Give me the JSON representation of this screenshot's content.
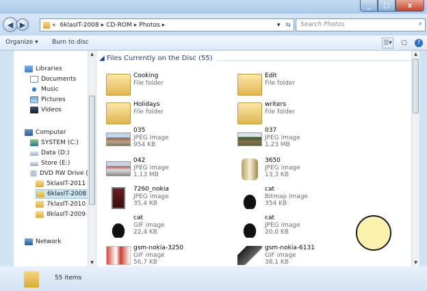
{
  "titlebar": {
    "minimize": "_",
    "maximize": "□",
    "close": "x"
  },
  "nav": {
    "back": "◀",
    "forward": "▶",
    "chevron": "«",
    "crumbs": [
      "6klasIT-2008",
      "CD-ROM",
      "Photos"
    ],
    "search_placeholder": "Search Photos"
  },
  "commands": {
    "organize": "Organize ▾",
    "burn": "Burn to disc"
  },
  "sidebar": {
    "items": [
      {
        "label": "Libraries",
        "icon": "libraries-icon"
      },
      {
        "label": "Documents",
        "icon": "documents-icon"
      },
      {
        "label": "Music",
        "icon": "music-icon"
      },
      {
        "label": "Pictures",
        "icon": "pictures-icon"
      },
      {
        "label": "Videos",
        "icon": "videos-icon"
      },
      {
        "label": "Computer",
        "icon": "computer-icon"
      },
      {
        "label": "SYSTEM (C:)",
        "icon": "system-drive-icon"
      },
      {
        "label": "Data (D:)",
        "icon": "drive-icon"
      },
      {
        "label": "Store (E:)",
        "icon": "drive-icon"
      },
      {
        "label": "DVD RW Drive (G",
        "icon": "dvd-drive-icon"
      },
      {
        "label": "5klasIT-2011",
        "icon": "folder-icon"
      },
      {
        "label": "6klasIT-2008",
        "icon": "folder-icon",
        "selected": true
      },
      {
        "label": "7klasIT-2010",
        "icon": "folder-icon"
      },
      {
        "label": "8klasIT-2009",
        "icon": "folder-icon"
      },
      {
        "label": "Network",
        "icon": "network-icon"
      }
    ]
  },
  "content": {
    "group_header": "Files Currently on the Disc (55)",
    "files": [
      {
        "name": "Cooking",
        "type": "File folder",
        "size": ""
      },
      {
        "name": "Edit",
        "type": "File folder",
        "size": ""
      },
      {
        "name": "Holidays",
        "type": "File folder",
        "size": ""
      },
      {
        "name": "writers",
        "type": "File folder",
        "size": ""
      },
      {
        "name": "035",
        "type": "JPEG image",
        "size": "954 KB"
      },
      {
        "name": "037",
        "type": "JPEG image",
        "size": "1,23 MB"
      },
      {
        "name": "042",
        "type": "JPEG image",
        "size": "1,13 MB"
      },
      {
        "name": "3650",
        "type": "JPEG image",
        "size": "13,3 KB"
      },
      {
        "name": "7260_nokia",
        "type": "JPEG image",
        "size": "35,4 KB"
      },
      {
        "name": "cat",
        "type": "Bitmap image",
        "size": "354 KB"
      },
      {
        "name": "cat",
        "type": "GIF image",
        "size": "22,4 KB"
      },
      {
        "name": "cat",
        "type": "JPEG image",
        "size": "20,0 KB"
      },
      {
        "name": "gsm-nokia-3250",
        "type": "GIF image",
        "size": "56,7 KB"
      },
      {
        "name": "gsm-nokia-6131",
        "type": "GIF image",
        "size": "38,1 KB"
      }
    ]
  },
  "status": {
    "count": "55 items"
  }
}
